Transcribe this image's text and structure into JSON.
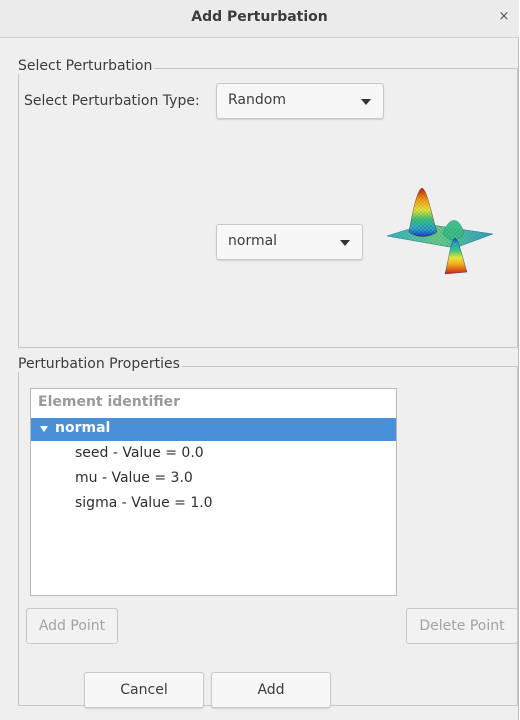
{
  "dialog": {
    "title": "Add Perturbation",
    "close_glyph": "×"
  },
  "select_group": {
    "title": "Select Perturbation",
    "type_label": "Select Perturbation Type:",
    "type_value": "Random",
    "distribution_value": "normal",
    "preview_icon": "gaussian-surface-plot-icon"
  },
  "properties_group": {
    "title": "Perturbation Properties",
    "tree": {
      "header": "Element identifier",
      "parent": "normal",
      "children": [
        "seed - Value = 0.0",
        "mu - Value = 3.0",
        "sigma - Value = 1.0"
      ]
    },
    "add_point_label": "Add Point",
    "delete_point_label": "Delete Point"
  },
  "footer": {
    "cancel_label": "Cancel",
    "add_label": "Add"
  },
  "colors": {
    "selection": "#4a90d9",
    "window_bg": "#efefef"
  }
}
